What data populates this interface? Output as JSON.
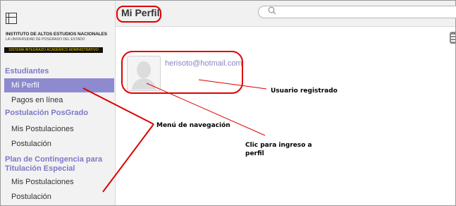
{
  "institution": {
    "name": "INSTITUTO DE ALTOS ESTUDIOS NACIONALES",
    "subtitle": "LA UNIVERSIDAD DE POSGRADO DEL ESTADO",
    "system": "SISTEMA INTEGRADO ACADÉMICO ADMINISTRATIVO"
  },
  "sidebar": {
    "sections": [
      {
        "title": "Estudiantes",
        "items": [
          {
            "label": "Mi Perfil",
            "active": true
          },
          {
            "label": "Pagos en línea"
          }
        ]
      },
      {
        "title": "Postulación PosGrado",
        "items": [
          {
            "label": "Mis Postulaciones"
          },
          {
            "label": "Postulación"
          }
        ]
      },
      {
        "title": "Plan de Contingencia para Titulación Especial",
        "title_line1": "Plan de Contingencia para",
        "title_line2": "Titulación Especial",
        "items": [
          {
            "label": "Mis Postulaciones"
          },
          {
            "label": "Postulación"
          }
        ]
      }
    ]
  },
  "header": {
    "title": "Mi Perfil",
    "search_placeholder": ""
  },
  "profile": {
    "email": "herisoto@hotmail.com"
  },
  "annotations": {
    "user": "Usuario registrado",
    "nav": "Menú de navegación",
    "click_line1": "Clic para ingreso a",
    "click_line2": "perfil"
  },
  "colors": {
    "accent": "#8e8ad0",
    "section_title": "#7b79c8",
    "annotation": "#e00000",
    "email": "#8a84c4"
  }
}
